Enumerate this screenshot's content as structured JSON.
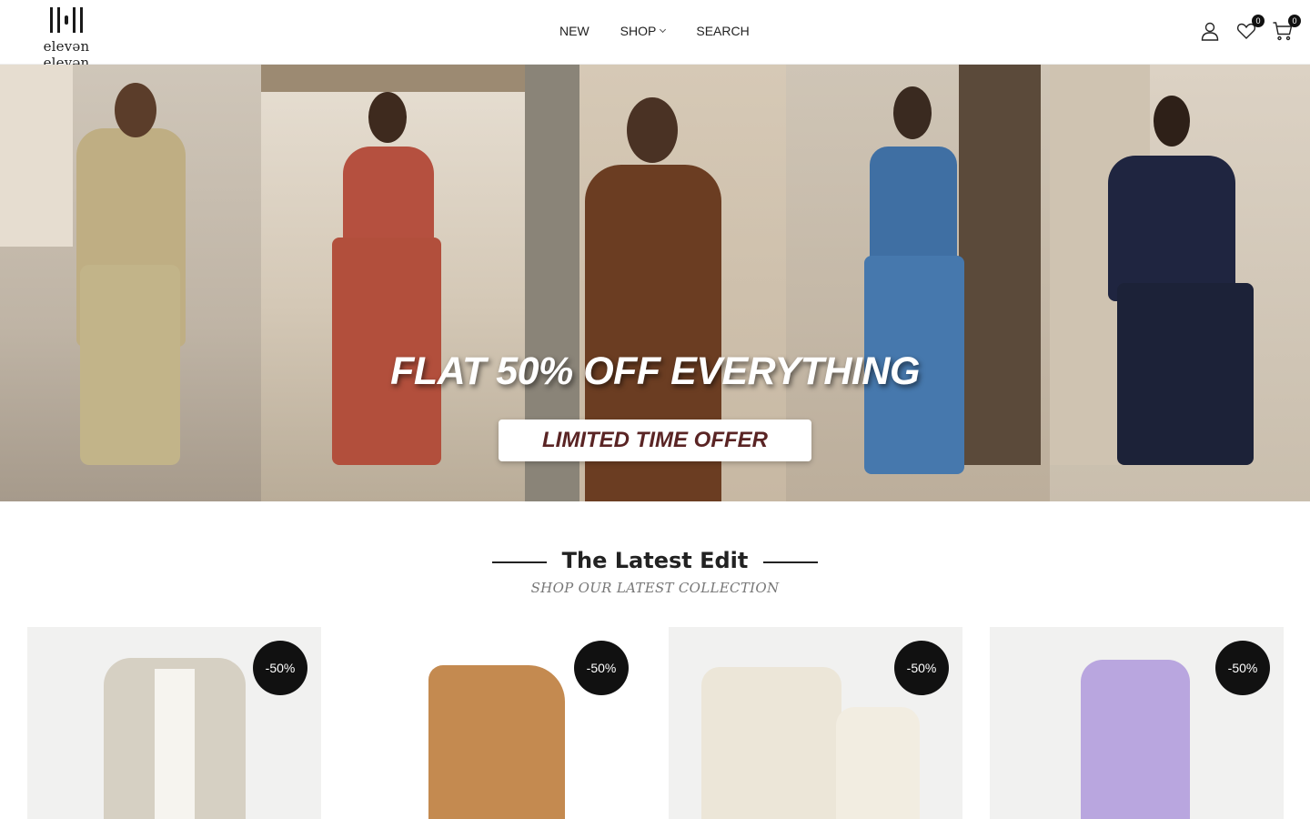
{
  "brand": {
    "name": "elevǝn elevǝn"
  },
  "nav": {
    "items": [
      "NEW",
      "SHOP",
      "SEARCH"
    ]
  },
  "header_icons": {
    "wishlist_count": "0",
    "cart_count": "0"
  },
  "hero": {
    "headline": "FLAT 50% OFF EVERYTHING",
    "cta": "LIMITED TIME OFFER"
  },
  "section": {
    "title": "The Latest Edit",
    "subtitle": "SHOP OUR LATEST COLLECTION"
  },
  "products": [
    {
      "badge": "-50%"
    },
    {
      "badge": "-50%"
    },
    {
      "badge": "-50%"
    },
    {
      "badge": "-50%"
    }
  ],
  "colors": {
    "accent": "#111111",
    "cta_text": "#5a2424"
  }
}
